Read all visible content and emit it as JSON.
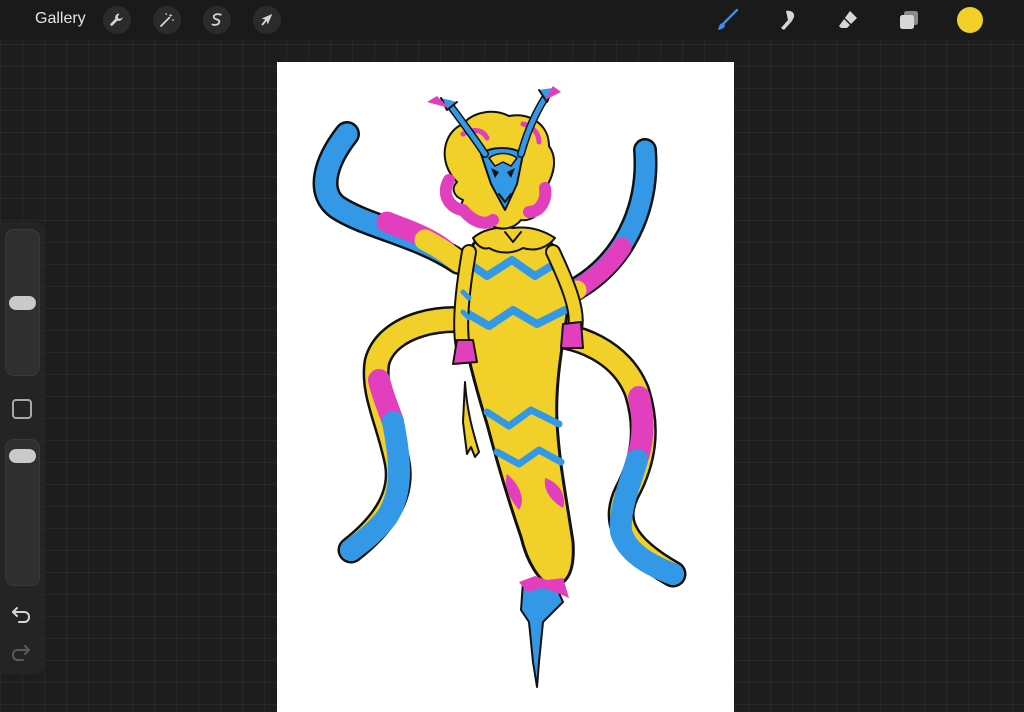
{
  "topbar": {
    "gallery_label": "Gallery",
    "left_tools": [
      {
        "icon": "wrench-icon",
        "name": "actions"
      },
      {
        "icon": "magic-wand-icon",
        "name": "adjustments"
      },
      {
        "icon": "selection-s-icon",
        "name": "selection"
      },
      {
        "icon": "arrow-cursor-icon",
        "name": "transform"
      }
    ],
    "right_tools": [
      {
        "icon": "brush-icon",
        "name": "brush",
        "active": true
      },
      {
        "icon": "smudge-icon",
        "name": "smudge"
      },
      {
        "icon": "eraser-icon",
        "name": "eraser"
      },
      {
        "icon": "layers-icon",
        "name": "layers"
      }
    ],
    "current_color": "#f2d02a"
  },
  "sidebar": {
    "brush_size_level": 0.5,
    "opacity_level": 0.96,
    "modify_icon": "square-icon",
    "undo_icon": "undo-arrow-icon",
    "redo_icon": "redo-arrow-icon"
  },
  "canvas": {
    "background": "#ffffff",
    "artwork_colors": {
      "yellow": "#f2d02a",
      "blue": "#3399e6",
      "magenta": "#e23fbf",
      "outline": "#111111"
    }
  },
  "colors": {
    "accent_brush": "#3a8df5",
    "icon": "#d6d6d6"
  }
}
